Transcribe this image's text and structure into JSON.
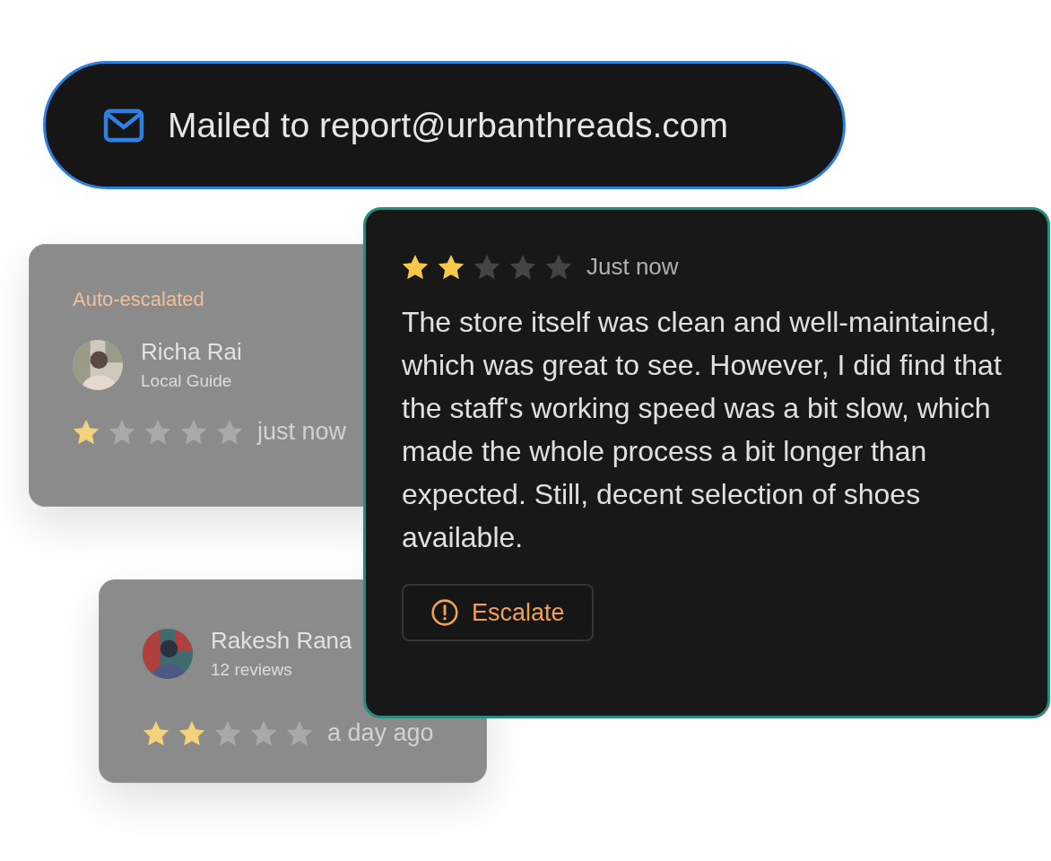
{
  "email_banner": {
    "text": "Mailed to report@urbanthreads.com"
  },
  "review_cards": [
    {
      "tag": "Auto-escalated",
      "author": "Richa Rai",
      "subtitle": "Local Guide",
      "stars": 1,
      "time": "just now"
    },
    {
      "author": "Rakesh Rana",
      "subtitle": "12 reviews",
      "stars": 2,
      "time": "a day ago"
    }
  ],
  "active_review": {
    "stars": 2,
    "time": "Just now",
    "text": "The store itself was clean and well-maintained, which was great to see. However, I did find that the staff's working speed was a bit slow, which made the whole process a bit longer than expected. Still, decent selection of shoes available.",
    "button": "Escalate"
  }
}
